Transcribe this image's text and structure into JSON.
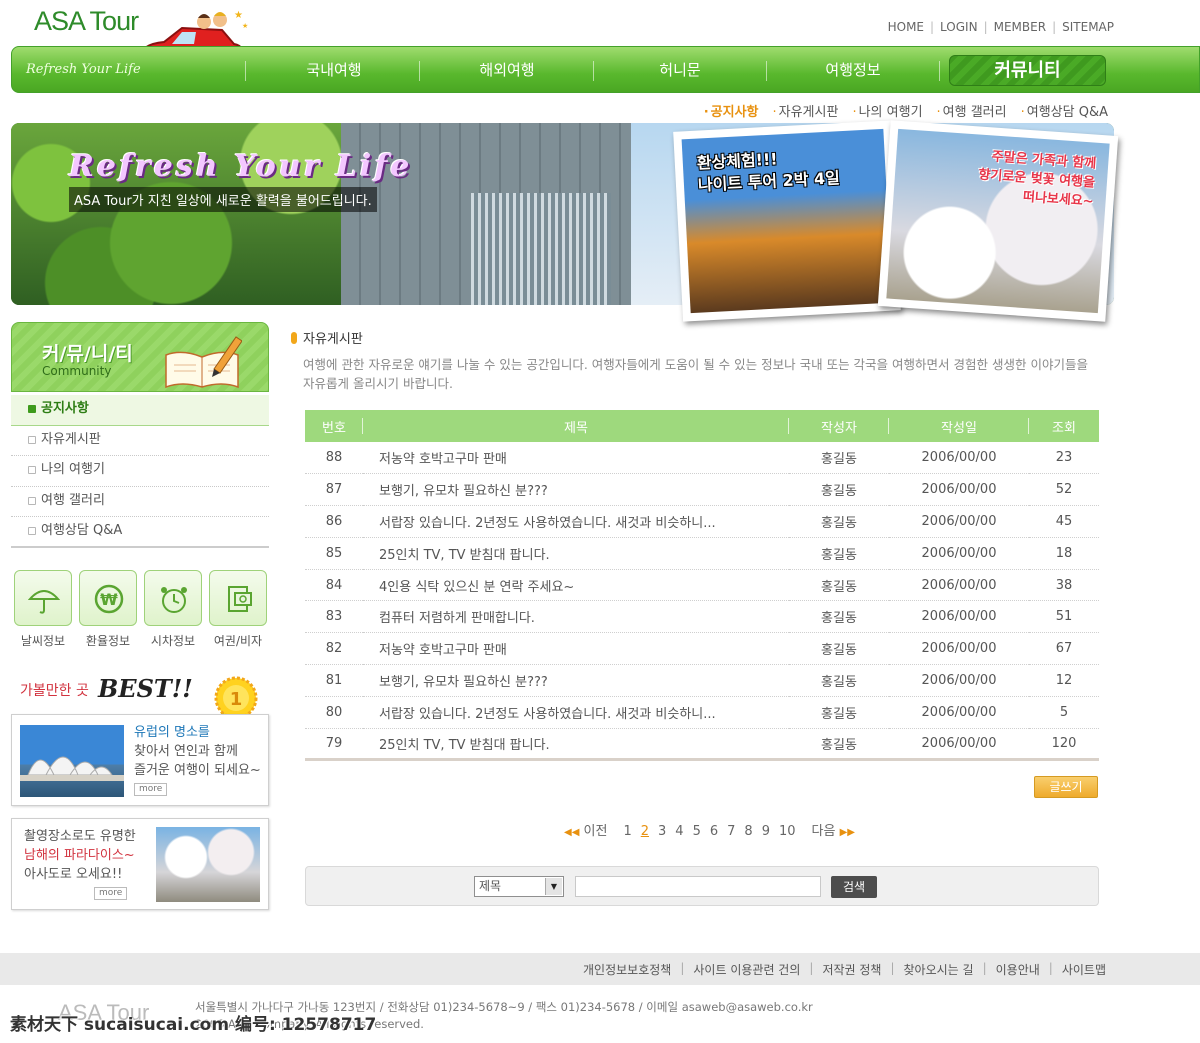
{
  "brand": {
    "logo": "ASA Tour",
    "tagline": "Refresh Your Life"
  },
  "top_links": [
    "HOME",
    "LOGIN",
    "MEMBER",
    "SITEMAP"
  ],
  "nav": {
    "items": [
      "국내여행",
      "해외여행",
      "허니문",
      "여행정보"
    ],
    "active": "커뮤니티"
  },
  "subnav": {
    "items": [
      "공지사항",
      "자유게시판",
      "나의 여행기",
      "여행 갤러리",
      "여행상담 Q&A"
    ]
  },
  "banner": {
    "title": "Refresh Your Life",
    "subtitle": "ASA Tour가 지친 일상에 새로운 활력을 불어드립니다.",
    "photo1": {
      "line1": "환상체험!!!",
      "line2": "나이트 투어 2박 4일"
    },
    "photo2": {
      "line1": "주말은 가족과 함께",
      "line2": "향기로운 벚꽃 여행을",
      "line3": "떠나보세요~"
    }
  },
  "sidebar": {
    "title": "커/뮤/니/티",
    "subtitle": "Community",
    "menu": [
      "공지사항",
      "자유게시판",
      "나의 여행기",
      "여행 갤러리",
      "여행상담 Q&A"
    ],
    "quick": [
      {
        "label": "날씨정보",
        "icon": "umbrella-icon"
      },
      {
        "label": "환율정보",
        "icon": "won-icon"
      },
      {
        "label": "시차정보",
        "icon": "alarm-clock-icon"
      },
      {
        "label": "여권/비자",
        "icon": "passport-icon"
      }
    ],
    "best": {
      "title": "가볼만한 곳",
      "word": "BEST!!",
      "medal": "1"
    },
    "promo1": {
      "line1": "유럽의 명소를",
      "line2": "찾아서 연인과 함께",
      "line3": "즐거운 여행이 되세요~",
      "more": "more"
    },
    "promo2": {
      "line1": "촬영장소로도 유명한",
      "line2": "남해의 파라다이스~",
      "line3": "아사도로 오세요!!",
      "more": "more"
    }
  },
  "board": {
    "title": "자유게시판",
    "description": "여행에 관한 자유로운 얘기를 나눌 수 있는 공간입니다. 여행자들에게 도움이 될 수 있는 정보나 국내 또는 각국을 여행하면서 경험한 생생한 이야기들을 자유롭게 올리시기 바랍니다.",
    "columns": [
      "번호",
      "제목",
      "작성자",
      "작성일",
      "조회"
    ],
    "rows": [
      {
        "no": "88",
        "title": "저농약 호박고구마 판매",
        "author": "홍길동",
        "date": "2006/00/00",
        "views": "23"
      },
      {
        "no": "87",
        "title": "보행기, 유모차 필요하신 분???",
        "author": "홍길동",
        "date": "2006/00/00",
        "views": "52"
      },
      {
        "no": "86",
        "title": "서랍장 있습니다. 2년정도 사용하였습니다. 새것과 비슷하니...",
        "author": "홍길동",
        "date": "2006/00/00",
        "views": "45"
      },
      {
        "no": "85",
        "title": "25인치 TV, TV 받침대 팝니다.",
        "author": "홍길동",
        "date": "2006/00/00",
        "views": "18"
      },
      {
        "no": "84",
        "title": "4인용 식탁 있으신 분 연락 주세요~",
        "author": "홍길동",
        "date": "2006/00/00",
        "views": "38"
      },
      {
        "no": "83",
        "title": "컴퓨터 저렴하게 판매합니다.",
        "author": "홍길동",
        "date": "2006/00/00",
        "views": "51"
      },
      {
        "no": "82",
        "title": "저농약 호박고구마 판매",
        "author": "홍길동",
        "date": "2006/00/00",
        "views": "67"
      },
      {
        "no": "81",
        "title": "보행기, 유모차 필요하신 분???",
        "author": "홍길동",
        "date": "2006/00/00",
        "views": "12"
      },
      {
        "no": "80",
        "title": "서랍장 있습니다. 2년정도 사용하였습니다. 새것과 비슷하니...",
        "author": "홍길동",
        "date": "2006/00/00",
        "views": "5"
      },
      {
        "no": "79",
        "title": "25인치 TV, TV 받침대 팝니다.",
        "author": "홍길동",
        "date": "2006/00/00",
        "views": "120"
      }
    ],
    "write_label": "글쓰기"
  },
  "pager": {
    "prev": "이전",
    "next": "다음",
    "pages": [
      "1",
      "2",
      "3",
      "4",
      "5",
      "6",
      "7",
      "8",
      "9",
      "10"
    ],
    "current": "2"
  },
  "search": {
    "field_option": "제목",
    "button": "검색",
    "input_value": ""
  },
  "footer": {
    "links": [
      "개인정보보호정책",
      "사이트 이용관련 건의",
      "저작권 정책",
      "찾아오시는 길",
      "이용안내",
      "사이트맵"
    ],
    "logo": "ASA Tour",
    "address": "서울특별시 가나다구 가나동 123번지  /  전화상담 01)234-5678~9  /  팩스 01)234-5678  /  이메일  asaweb@asaweb.co.kr",
    "copyright": "2006 ASA Company. All rights reserved.",
    "watermark": "素材天下 sucaisucai.com  编号: 12578717"
  },
  "colors": {
    "nav_green": "#59b82d",
    "table_head": "#9ed97d",
    "accent_orange": "#e8910f",
    "best_red": "#d2333f"
  }
}
